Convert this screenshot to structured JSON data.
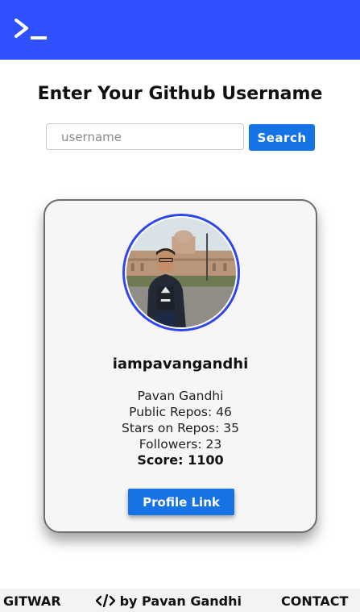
{
  "header": {
    "logo_icon": "terminal-prompt-icon",
    "background": "#304ffe"
  },
  "main": {
    "heading": "Enter Your Github Username",
    "search": {
      "placeholder": "username",
      "value": "",
      "button_label": "Search"
    }
  },
  "profile": {
    "avatar_icon": "user-avatar-photo",
    "username": "iampavangandhi",
    "name": "Pavan Gandhi",
    "public_repos": "Public Repos: 46",
    "stars": "Stars on Repos: 35",
    "followers": "Followers: 23",
    "score": "Score: 1100",
    "link_label": "Profile Link"
  },
  "footer": {
    "brand": "GITWAR",
    "credit": "by Pavan Gandhi",
    "credit_icon": "code-icon",
    "contact": "CONTACT"
  },
  "colors": {
    "accent": "#304ffe",
    "button": "#1673e6",
    "card_bg": "#f6f6f6"
  }
}
